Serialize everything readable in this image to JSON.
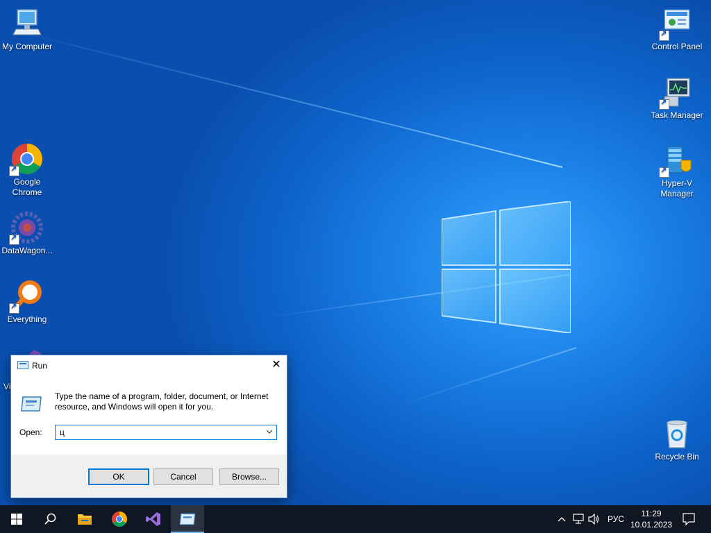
{
  "desktop": {
    "icons_left": [
      {
        "label": "My Computer"
      },
      {
        "label": "Google Chrome"
      },
      {
        "label": "DataWagon..."
      },
      {
        "label": "Everything"
      },
      {
        "label": "Vi"
      }
    ],
    "icons_right": [
      {
        "label": "Control Panel"
      },
      {
        "label": "Task Manager"
      },
      {
        "label": "Hyper-V Manager"
      },
      {
        "label": "Recycle Bin"
      }
    ]
  },
  "run_dialog": {
    "title": "Run",
    "close_glyph": "✕",
    "description": "Type the name of a program, folder, document, or Internet resource, and Windows will open it for you.",
    "open_label": "Open:",
    "open_value": "ц",
    "ok_label": "OK",
    "cancel_label": "Cancel",
    "browse_label": "Browse..."
  },
  "taskbar": {
    "language": "РУС",
    "time": "11:29",
    "date": "10.01.2023"
  },
  "colors": {
    "taskbar_bg": "#101722",
    "accent": "#0078d7"
  }
}
